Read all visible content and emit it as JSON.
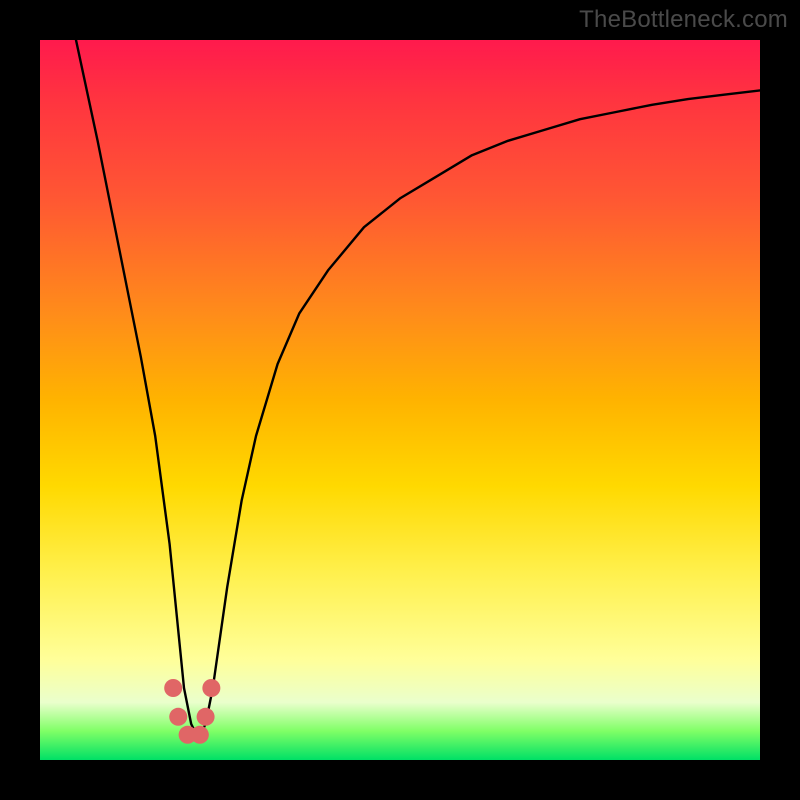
{
  "watermark": "TheBottleneck.com",
  "chart_data": {
    "type": "line",
    "title": "",
    "xlabel": "",
    "ylabel": "",
    "xlim": [
      0,
      100
    ],
    "ylim": [
      0,
      100
    ],
    "series": [
      {
        "name": "bottleneck-curve",
        "x": [
          5,
          8,
          10,
          12,
          14,
          16,
          18,
          19,
          20,
          21,
          22,
          23,
          24,
          26,
          28,
          30,
          33,
          36,
          40,
          45,
          50,
          55,
          60,
          65,
          70,
          75,
          80,
          85,
          90,
          95,
          100
        ],
        "values": [
          100,
          86,
          76,
          66,
          56,
          45,
          30,
          20,
          10,
          5,
          3,
          5,
          10,
          24,
          36,
          45,
          55,
          62,
          68,
          74,
          78,
          81,
          84,
          86,
          87.5,
          89,
          90,
          91,
          91.8,
          92.4,
          93
        ]
      }
    ],
    "markers": {
      "name": "highlight-dots",
      "color": "#e06666",
      "radius_px": 9,
      "points": [
        {
          "x": 18.5,
          "y": 10
        },
        {
          "x": 19.2,
          "y": 6
        },
        {
          "x": 20.5,
          "y": 3.5
        },
        {
          "x": 22.2,
          "y": 3.5
        },
        {
          "x": 23.0,
          "y": 6
        },
        {
          "x": 23.8,
          "y": 10
        }
      ]
    }
  }
}
